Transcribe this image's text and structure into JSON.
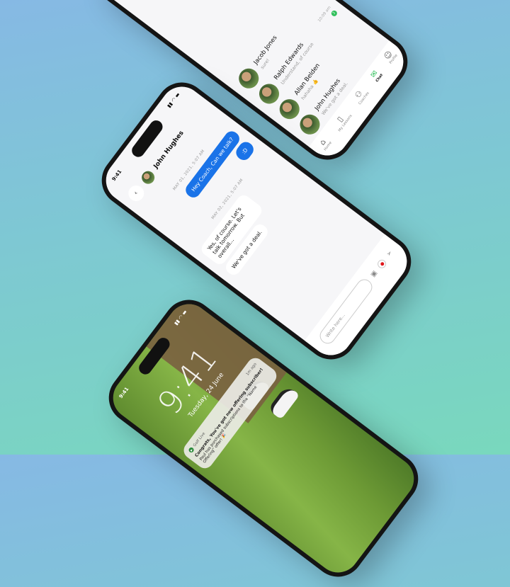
{
  "chat_list_phone": {
    "conversations": [
      {
        "name": "Jacob Jones",
        "message": "sure!",
        "time": ""
      },
      {
        "name": "Ralph Edwards",
        "message": "Understand, of course",
        "time": "10:09 am",
        "unread": "3"
      },
      {
        "name": "Allan Belden",
        "message": "hahaha 👍",
        "time": ""
      },
      {
        "name": "John Hughes",
        "message": "We've got a deal.",
        "time": ""
      }
    ],
    "tabs": [
      {
        "label": "Home",
        "icon": "home-icon"
      },
      {
        "label": "My Lessons",
        "icon": "book-icon"
      },
      {
        "label": "Coaches",
        "icon": "people-icon"
      },
      {
        "label": "Chat",
        "icon": "chat-icon",
        "active": true
      },
      {
        "label": "Profile",
        "icon": "user-icon"
      }
    ],
    "accent": "#2fbf5a"
  },
  "chat_phone": {
    "status_time": "9:41",
    "contact_name": "John Hughes",
    "messages": [
      {
        "timestamp": "MAY 01, 2021, 5:07 AM"
      },
      {
        "text": "Hey Coach, Can we talk?",
        "direction": "out"
      },
      {
        "text": ":D",
        "direction": "out"
      },
      {
        "timestamp": "MAY 02, 2021, 5:07 AM"
      },
      {
        "text": "Yes, of course. Let's talk tomorrow. But overall...",
        "direction": "in"
      },
      {
        "text": "We've got a deal.",
        "direction": "in"
      }
    ],
    "input_placeholder": "Write here...",
    "bubble_color": "#1a73e8",
    "record_color": "#e0161b"
  },
  "lock_phone": {
    "status_time": "9:41",
    "time": "9:41",
    "date": "Tuesday, 24 June",
    "notification": {
      "app": "Golf Live",
      "age": "1m ago",
      "title": "Congrats, You've got new offering subscriber!",
      "body": "Paul has purchased subscriptions to the “Name Offering” offer! 🎉"
    }
  }
}
